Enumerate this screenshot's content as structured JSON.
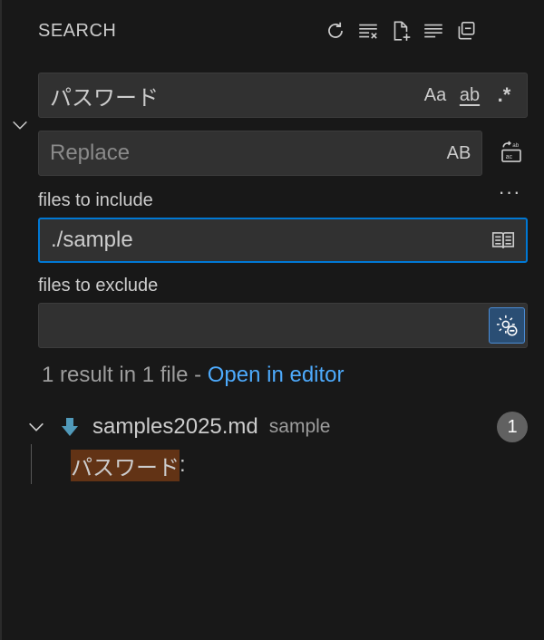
{
  "header": {
    "title": "SEARCH",
    "actions": [
      "refresh-icon",
      "clear-results-icon",
      "new-search-editor-icon",
      "view-as-tree-icon",
      "collapse-all-icon"
    ]
  },
  "search": {
    "value": "パスワード",
    "options": {
      "match_case": "Aa",
      "whole_word": "ab",
      "regex": ".*"
    }
  },
  "replace": {
    "value": "",
    "placeholder": "Replace",
    "preserve_case": "AB",
    "replace_all_icon": "replace-all-icon"
  },
  "more": "···",
  "include": {
    "label": "files to include",
    "value": "./sample",
    "icon": "open-editors-only-icon"
  },
  "exclude": {
    "label": "files to exclude",
    "value": "",
    "icon": "use-exclude-settings-icon"
  },
  "summary": {
    "text": "1 result in 1 file - ",
    "link": "Open in editor"
  },
  "results": {
    "file_name": "samples2025.md",
    "file_path": "sample",
    "count": "1",
    "match_text": "パスワード",
    "match_suffix": ":"
  },
  "colors": {
    "background": "#181818",
    "input_bg": "#313131",
    "focus_border": "#0078d4",
    "link": "#4daafc",
    "match_highlight": "#623315",
    "file_icon": "#519aba"
  }
}
